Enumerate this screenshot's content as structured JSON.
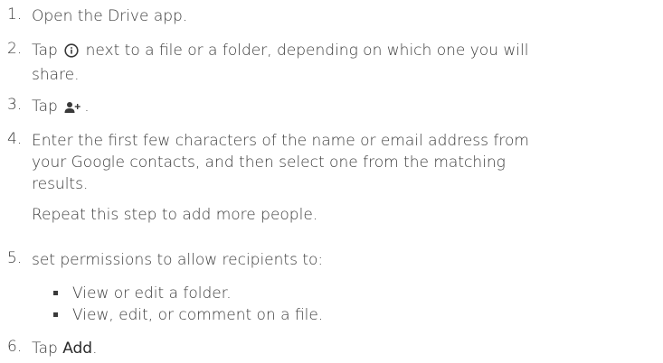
{
  "steps": [
    {
      "number": "1.",
      "lines": [
        "Open the Drive app."
      ]
    },
    {
      "number": "2.",
      "before_icon": "Tap",
      "icon": "info-circle-icon",
      "after_icon": "next to a file or a folder, depending on which one you will",
      "line2": "share."
    },
    {
      "number": "3.",
      "before_icon": "Tap",
      "icon": "add-person-icon",
      "after_icon": "."
    },
    {
      "number": "4.",
      "lines": [
        "Enter the first few characters of the name or email address from",
        "your Google contacts, and then select one from the matching",
        "results."
      ],
      "note": "Repeat this step to add more people."
    },
    {
      "number": "5.",
      "lines": [
        "set permissions to allow recipients to:"
      ],
      "bullets": [
        "View or edit a folder.",
        "View, edit, or comment on a file."
      ]
    },
    {
      "number": "6.",
      "before": "Tap",
      "emphasis": "Add",
      "after": "."
    }
  ]
}
